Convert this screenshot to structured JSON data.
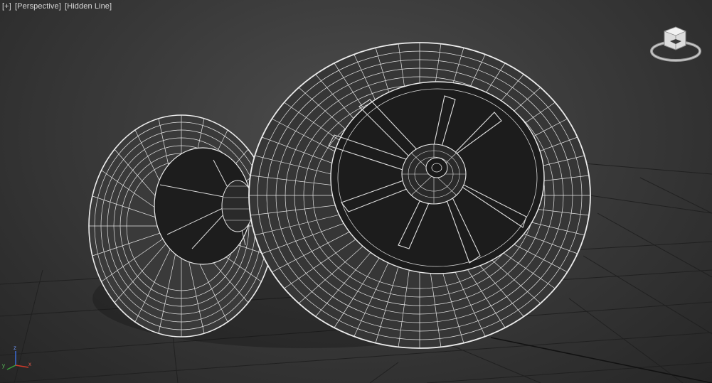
{
  "viewport": {
    "labels": {
      "menu": "[+]",
      "camera": "[Perspective]",
      "shading": "[Hidden Line]"
    },
    "axis": {
      "x": "x",
      "y": "y",
      "z": "z"
    },
    "colors": {
      "background": "#3a3a3a",
      "wire": "#f0f0f0",
      "grid": "#1e1e1e",
      "axis_x": "#d23a2a",
      "axis_y": "#3aa03a",
      "axis_z": "#3a6ad6"
    },
    "icons": {
      "viewcube": "viewcube-icon",
      "axis_tripod": "axis-tripod-icon"
    }
  }
}
